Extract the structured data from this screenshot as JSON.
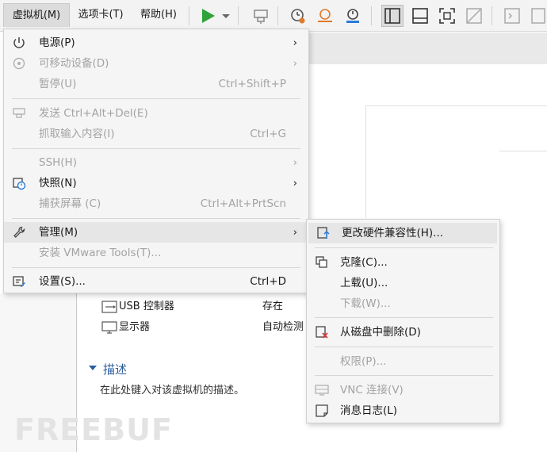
{
  "menubar": {
    "vm": "虚拟机(M)",
    "tabs": "选项卡(T)",
    "help": "帮助(H)"
  },
  "toolbar_icons": [
    "play-icon",
    "dropdown-arrow-icon",
    "send-keys-icon",
    "snapshot-icon",
    "revert-snapshot-icon",
    "manage-snapshot-icon",
    "sidebar-view-icon",
    "console-view-icon",
    "fullscreen-icon",
    "unity-icon",
    "terminal-icon",
    "thumbnail-icon"
  ],
  "vm_menu": {
    "items": [
      {
        "label": "电源(P)",
        "shortcut": "",
        "submenu": true,
        "disabled": false,
        "icon": "power-icon"
      },
      {
        "label": "可移动设备(D)",
        "shortcut": "",
        "submenu": true,
        "disabled": true,
        "icon": "removable-device-icon"
      },
      {
        "label": "暂停(U)",
        "shortcut": "Ctrl+Shift+P",
        "submenu": false,
        "disabled": true,
        "icon": ""
      },
      {
        "label": "发送 Ctrl+Alt+Del(E)",
        "shortcut": "",
        "submenu": false,
        "disabled": true,
        "icon": "send-keys-icon"
      },
      {
        "label": "抓取输入内容(I)",
        "shortcut": "Ctrl+G",
        "submenu": false,
        "disabled": true,
        "icon": ""
      },
      {
        "label": "SSH(H)",
        "shortcut": "",
        "submenu": true,
        "disabled": true,
        "icon": ""
      },
      {
        "label": "快照(N)",
        "shortcut": "",
        "submenu": true,
        "disabled": false,
        "icon": "snapshot-icon"
      },
      {
        "label": "捕获屏幕 (C)",
        "shortcut": "Ctrl+Alt+PrtScn",
        "submenu": false,
        "disabled": true,
        "icon": ""
      },
      {
        "label": "管理(M)",
        "shortcut": "",
        "submenu": true,
        "disabled": false,
        "icon": "wrench-icon"
      },
      {
        "label": "安装 VMware Tools(T)...",
        "shortcut": "",
        "submenu": false,
        "disabled": true,
        "icon": ""
      },
      {
        "label": "设置(S)...",
        "shortcut": "Ctrl+D",
        "submenu": false,
        "disabled": false,
        "icon": "settings-icon"
      }
    ],
    "arrow": "›"
  },
  "manage_menu": {
    "items": [
      {
        "label": "更改硬件兼容性(H)...",
        "disabled": false,
        "icon": "hardware-compat-icon"
      },
      {
        "label": "克隆(C)...",
        "disabled": false,
        "icon": "clone-icon"
      },
      {
        "label": "上载(U)...",
        "disabled": false,
        "icon": ""
      },
      {
        "label": "下载(W)...",
        "disabled": true,
        "icon": ""
      },
      {
        "label": "从磁盘中删除(D)",
        "disabled": false,
        "icon": "delete-from-disk-icon"
      },
      {
        "label": "权限(P)...",
        "disabled": true,
        "icon": ""
      },
      {
        "label": "VNC 连接(V)",
        "disabled": true,
        "icon": "vnc-icon"
      },
      {
        "label": "消息日志(L)",
        "disabled": false,
        "icon": "message-log-icon"
      }
    ]
  },
  "hardware": [
    {
      "name": "USB 控制器",
      "value": "存在",
      "icon": "usb-icon"
    },
    {
      "name": "显示器",
      "value": "自动检测",
      "icon": "monitor-icon"
    }
  ],
  "description": {
    "title": "描述",
    "placeholder": "在此处键入对该虚拟机的描述。"
  },
  "watermark": "FREEBUF"
}
